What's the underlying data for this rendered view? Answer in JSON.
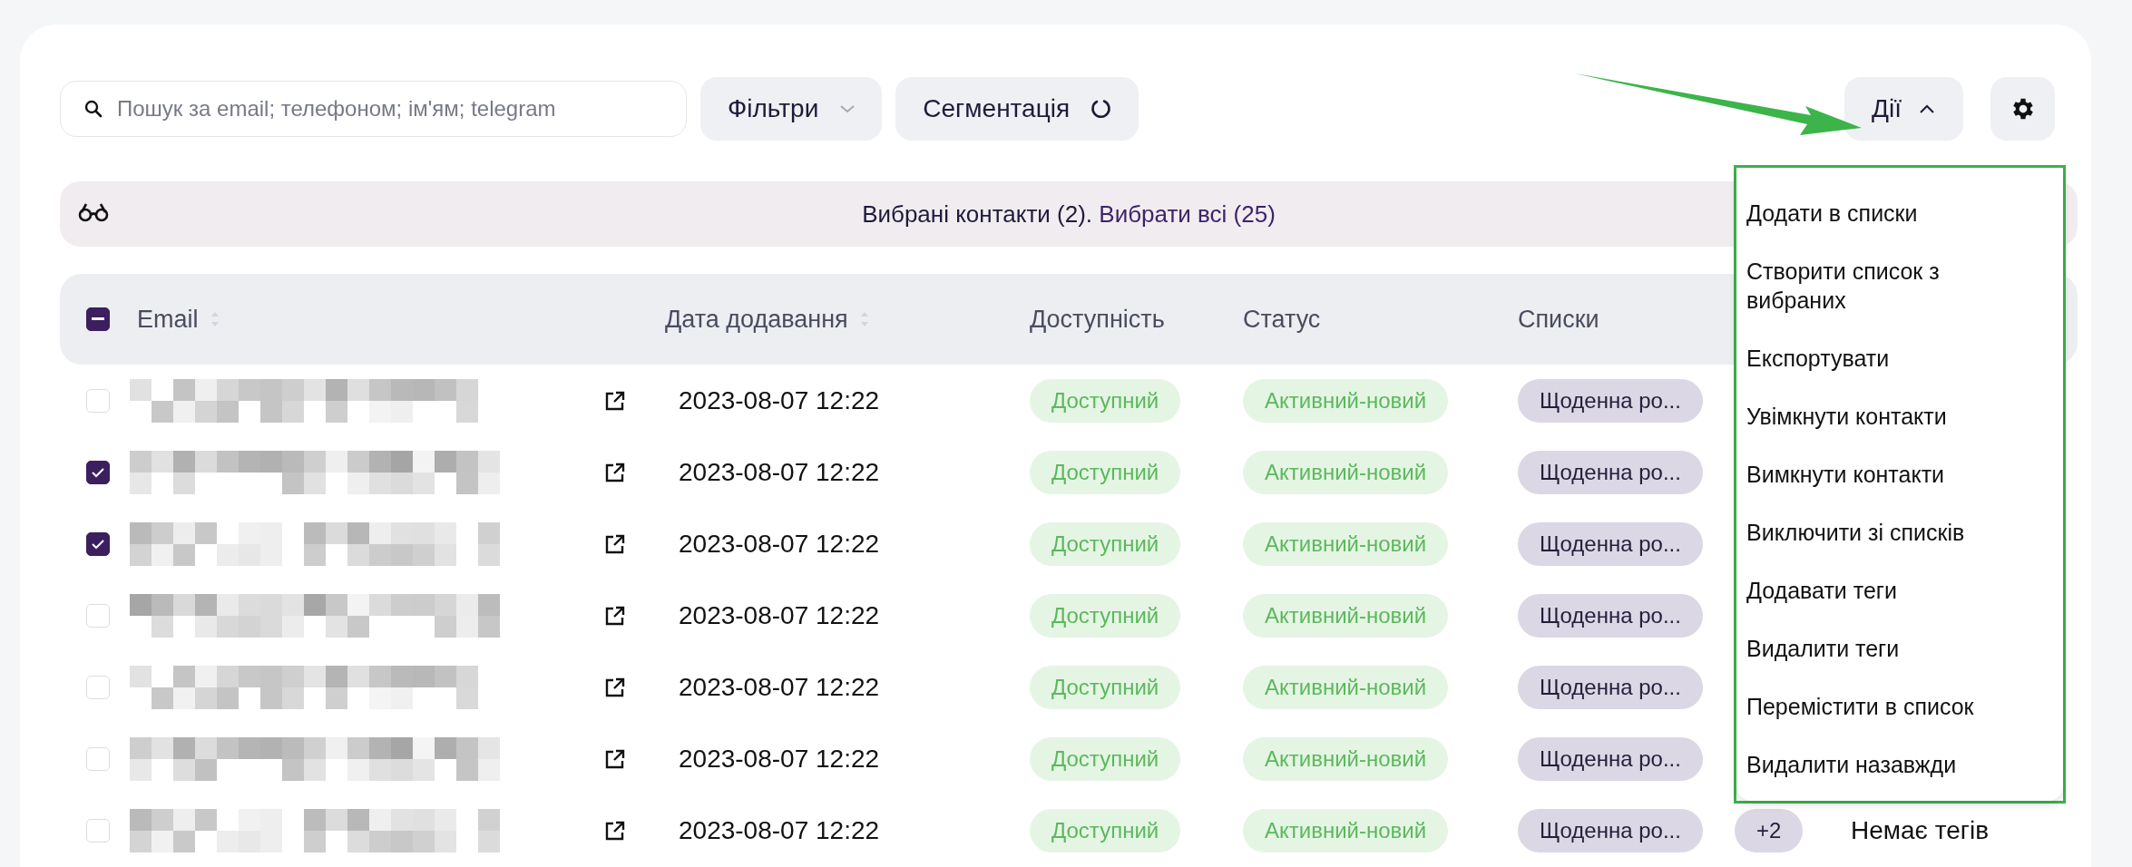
{
  "search": {
    "placeholder": "Пошук за email; телефоном; ім'ям; telegram"
  },
  "toolbar_buttons": [
    {
      "label": "Фільтри",
      "kind": "dropdown"
    },
    {
      "label": "Сегментація",
      "kind": "refresh"
    }
  ],
  "actions_button": {
    "label": "Дії",
    "expanded": true
  },
  "selection_banner": {
    "text": "Вибрані контакти (2).",
    "link": "Вибрати всі (25)"
  },
  "table": {
    "select_all": {
      "indeterminate": true
    },
    "columns": [
      {
        "label": "Email",
        "sortable": true
      },
      {
        "label": "Дата додавання",
        "sortable": true
      },
      {
        "label": "Доступність",
        "sortable": false
      },
      {
        "label": "Статус",
        "sortable": false
      },
      {
        "label": "Списки",
        "sortable": false
      }
    ],
    "rows": [
      {
        "checked": false,
        "date": "2023-08-07 12:22",
        "availability": "Доступний",
        "status": "Активний-новий",
        "list": "Щоденна ро..."
      },
      {
        "checked": true,
        "date": "2023-08-07 12:22",
        "availability": "Доступний",
        "status": "Активний-новий",
        "list": "Щоденна ро..."
      },
      {
        "checked": true,
        "date": "2023-08-07 12:22",
        "availability": "Доступний",
        "status": "Активний-новий",
        "list": "Щоденна ро..."
      },
      {
        "checked": false,
        "date": "2023-08-07 12:22",
        "availability": "Доступний",
        "status": "Активний-новий",
        "list": "Щоденна ро..."
      },
      {
        "checked": false,
        "date": "2023-08-07 12:22",
        "availability": "Доступний",
        "status": "Активний-новий",
        "list": "Щоденна ро..."
      },
      {
        "checked": false,
        "date": "2023-08-07 12:22",
        "availability": "Доступний",
        "status": "Активний-новий",
        "list": "Щоденна ро..."
      },
      {
        "checked": false,
        "date": "2023-08-07 12:22",
        "availability": "Доступний",
        "status": "Активний-новий",
        "list": "Щоденна ро...",
        "extra_lists": "+2",
        "tags": "Немає тегів"
      }
    ]
  },
  "actions_menu": {
    "items": [
      "Додати в списки",
      "Створити список з вибраних",
      "Експортувати",
      "Увімкнути контакти",
      "Вимкнути контакти",
      "Виключити зі списків",
      "Додавати теги",
      "Видалити теги",
      "Перемістити в список",
      "Видалити назавжди"
    ]
  }
}
